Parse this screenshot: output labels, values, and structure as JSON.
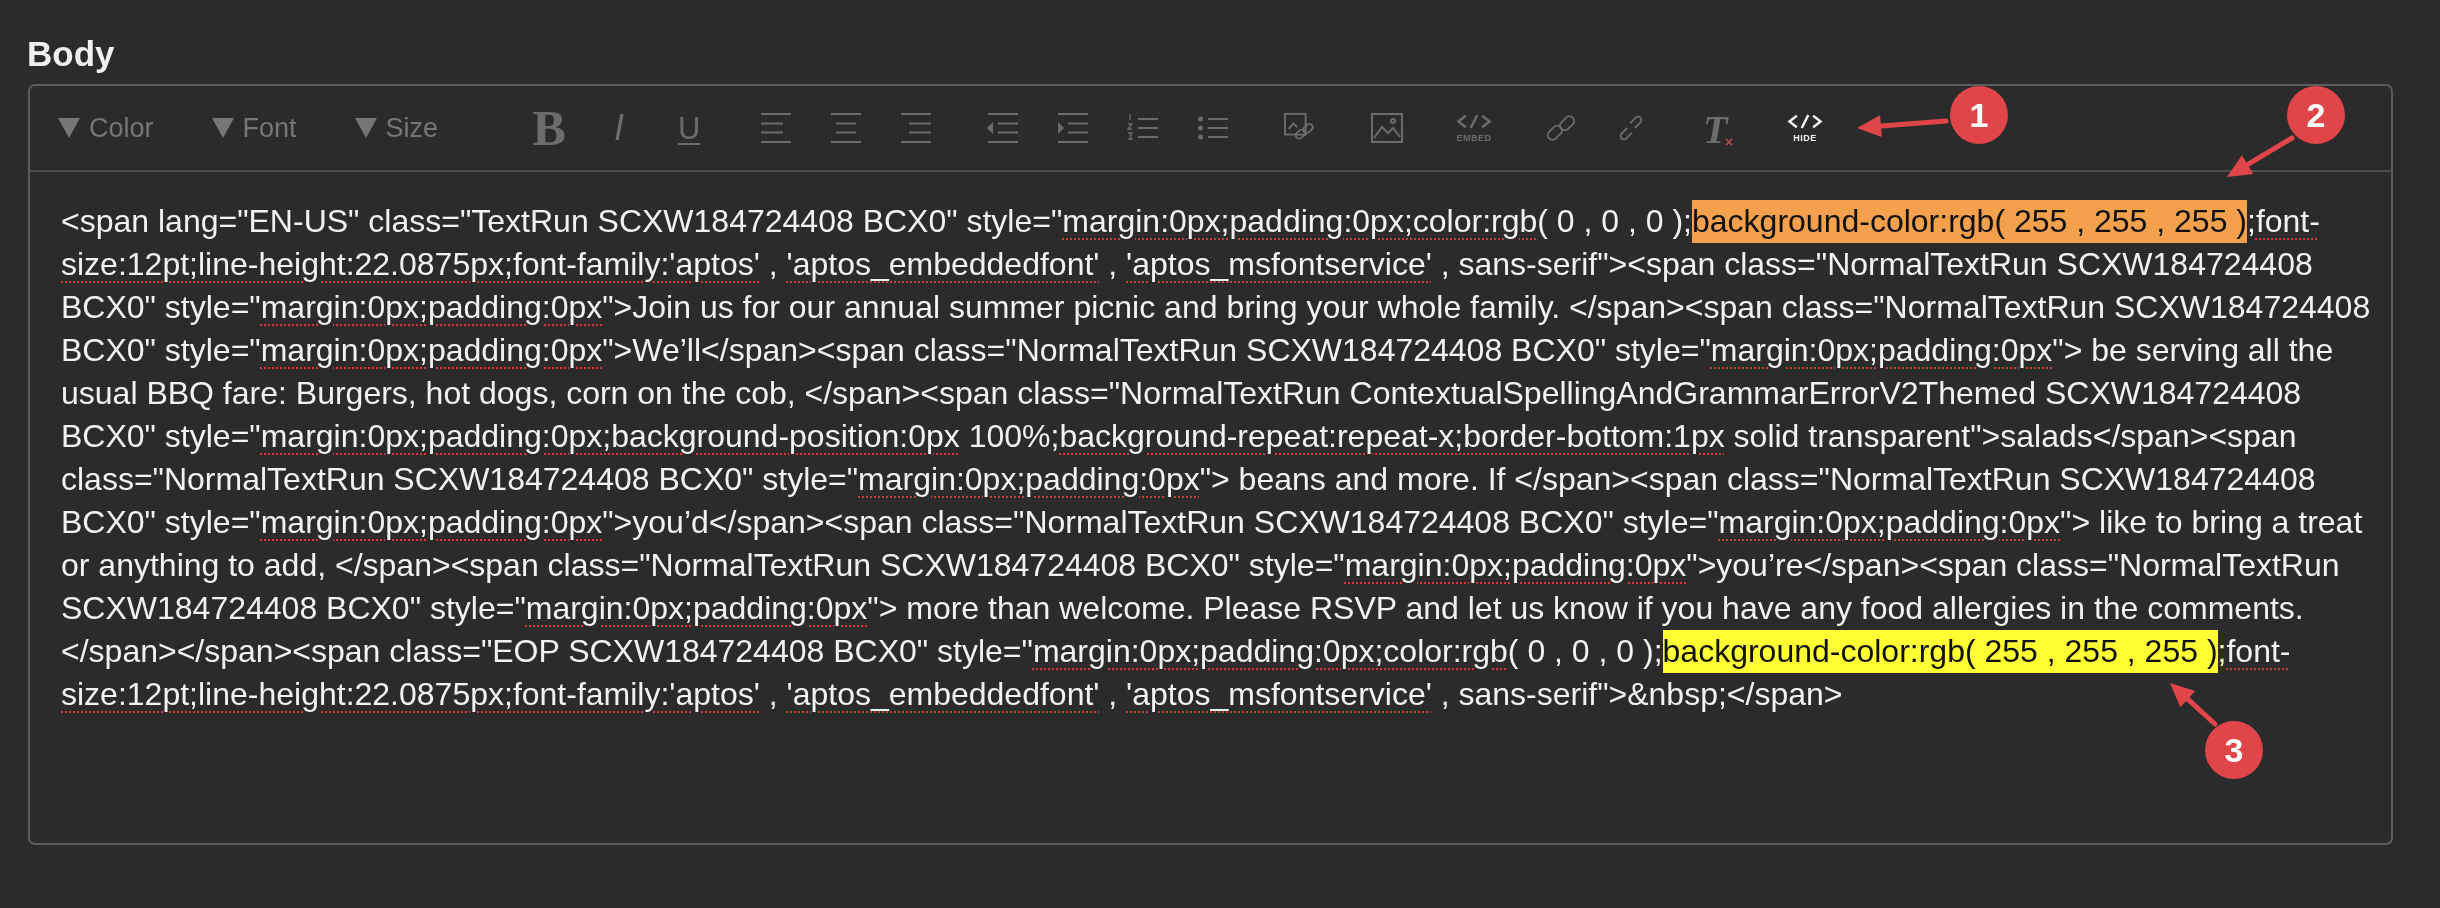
{
  "field": {
    "label": "Body"
  },
  "toolbar": {
    "dropdowns": [
      {
        "label": "Color",
        "disabled": true
      },
      {
        "label": "Font",
        "disabled": true
      },
      {
        "label": "Size",
        "disabled": true
      }
    ],
    "groups": [
      [
        {
          "kind": "bold",
          "label": "B",
          "disabled": true
        },
        {
          "kind": "italic",
          "label": "I",
          "disabled": true
        },
        {
          "kind": "underline",
          "label": "U",
          "disabled": true
        }
      ],
      [
        {
          "kind": "align-left",
          "disabled": true
        },
        {
          "kind": "align-center",
          "disabled": true
        },
        {
          "kind": "align-right",
          "disabled": true
        }
      ],
      [
        {
          "kind": "outdent",
          "disabled": true
        },
        {
          "kind": "indent",
          "disabled": true
        },
        {
          "kind": "numbered-list",
          "disabled": true
        },
        {
          "kind": "bulleted-list",
          "disabled": true
        }
      ],
      [
        {
          "kind": "media",
          "disabled": true
        }
      ],
      [
        {
          "kind": "image",
          "disabled": true
        }
      ],
      [
        {
          "kind": "embed",
          "label": "EMBED",
          "disabled": true
        }
      ],
      [
        {
          "kind": "link",
          "disabled": true
        },
        {
          "kind": "unlink",
          "disabled": true
        }
      ],
      [
        {
          "kind": "clear-format",
          "label": "T",
          "disabled": true
        }
      ],
      [
        {
          "kind": "source",
          "label": "HIDE",
          "disabled": false
        }
      ]
    ]
  },
  "editor": {
    "lines": [
      {
        "runs": [
          {
            "kind": "plain",
            "text": "<span lang=\"EN-US\" class=\"TextRun SCXW184724408 BCX0\" style=\""
          },
          {
            "kind": "misspelled",
            "text": "margin:0px;padding:0px;color:rgb"
          },
          {
            "kind": "plain",
            "text": "( 0 , 0 , 0 );"
          },
          {
            "kind": "highlight",
            "color": "#f4a04c",
            "text": "background-color:rgb( 255 , 255 , 255 )"
          },
          {
            "kind": "plain",
            "text": ";"
          },
          {
            "kind": "misspelled",
            "text": "font-"
          }
        ]
      },
      {
        "runs": [
          {
            "kind": "misspelled",
            "text": "size:12pt;line-height:22.0875px;font-family:'aptos'"
          },
          {
            "kind": "plain",
            "text": " , "
          },
          {
            "kind": "misspelled",
            "text": "'aptos_embeddedfont'"
          },
          {
            "kind": "plain",
            "text": " , "
          },
          {
            "kind": "misspelled",
            "text": "'aptos_msfontservice'"
          },
          {
            "kind": "plain",
            "text": " , sans-serif\"><span class=\"NormalTextRun SCXW184724408"
          }
        ]
      },
      {
        "runs": [
          {
            "kind": "plain",
            "text": "BCX0\" style=\""
          },
          {
            "kind": "misspelled",
            "text": "margin:0px;padding:0px"
          },
          {
            "kind": "plain",
            "text": "\">Join us for our annual summer picnic and bring your whole family. </span><span class=\"NormalTextRun SCXW184724408"
          }
        ]
      },
      {
        "runs": [
          {
            "kind": "plain",
            "text": "BCX0\" style=\""
          },
          {
            "kind": "misspelled",
            "text": "margin:0px;padding:0px"
          },
          {
            "kind": "plain",
            "text": "\">We’ll</span><span class=\"NormalTextRun SCXW184724408 BCX0\" style=\""
          },
          {
            "kind": "misspelled",
            "text": "margin:0px;padding:0px"
          },
          {
            "kind": "plain",
            "text": "\"> be serving all the"
          }
        ]
      },
      {
        "runs": [
          {
            "kind": "plain",
            "text": "usual BBQ fare: Burgers, hot dogs, corn on the cob, </span><span class=\"NormalTextRun ContextualSpellingAndGrammarErrorV2Themed SCXW184724408"
          }
        ]
      },
      {
        "runs": [
          {
            "kind": "plain",
            "text": "BCX0\" style=\""
          },
          {
            "kind": "misspelled",
            "text": "margin:0px;padding:0px;background-position:0px"
          },
          {
            "kind": "plain",
            "text": " 100%;"
          },
          {
            "kind": "misspelled",
            "text": "background-repeat:repeat-x;border-bottom:1px"
          },
          {
            "kind": "plain",
            "text": " solid transparent\">salads</span><span"
          }
        ]
      },
      {
        "runs": [
          {
            "kind": "plain",
            "text": "class=\"NormalTextRun SCXW184724408 BCX0\" style=\""
          },
          {
            "kind": "misspelled",
            "text": "margin:0px;padding:0px"
          },
          {
            "kind": "plain",
            "text": "\"> beans and more. If </span><span class=\"NormalTextRun SCXW184724408"
          }
        ]
      },
      {
        "runs": [
          {
            "kind": "plain",
            "text": "BCX0\" style=\""
          },
          {
            "kind": "misspelled",
            "text": "margin:0px;padding:0px"
          },
          {
            "kind": "plain",
            "text": "\">you’d</span><span class=\"NormalTextRun SCXW184724408 BCX0\" style=\""
          },
          {
            "kind": "misspelled",
            "text": "margin:0px;padding:0px"
          },
          {
            "kind": "plain",
            "text": "\"> like to bring a treat"
          }
        ]
      },
      {
        "runs": [
          {
            "kind": "plain",
            "text": "or anything to add, </span><span class=\"NormalTextRun SCXW184724408 BCX0\" style=\""
          },
          {
            "kind": "misspelled",
            "text": "margin:0px;padding:0px"
          },
          {
            "kind": "plain",
            "text": "\">you’re</span><span class=\"NormalTextRun"
          }
        ]
      },
      {
        "runs": [
          {
            "kind": "plain",
            "text": "SCXW184724408 BCX0\" style=\""
          },
          {
            "kind": "misspelled",
            "text": "margin:0px;padding:0px"
          },
          {
            "kind": "plain",
            "text": "\"> more than welcome. Please RSVP and let us know if you have any food allergies in the comments."
          }
        ]
      },
      {
        "runs": [
          {
            "kind": "plain",
            "text": "</span></span><span class=\"EOP SCXW184724408 BCX0\" style=\""
          },
          {
            "kind": "misspelled",
            "text": "margin:0px;padding:0px;color:rgb"
          },
          {
            "kind": "plain",
            "text": "( 0 , 0 , 0 );"
          },
          {
            "kind": "highlight",
            "color": "#ffff33",
            "text": "background-color:rgb( 255 , 255 , 255 )"
          },
          {
            "kind": "plain",
            "text": ";"
          },
          {
            "kind": "misspelled",
            "text": "font-"
          }
        ]
      },
      {
        "runs": [
          {
            "kind": "misspelled",
            "text": "size:12pt;line-height:22.0875px;font-family:'aptos'"
          },
          {
            "kind": "plain",
            "text": " , "
          },
          {
            "kind": "misspelled",
            "text": "'aptos_embeddedfont'"
          },
          {
            "kind": "plain",
            "text": " , "
          },
          {
            "kind": "misspelled",
            "text": "'aptos_msfontservice'"
          },
          {
            "kind": "plain",
            "text": " , sans-serif\">&nbsp;</span>"
          }
        ]
      }
    ]
  },
  "annotations": [
    {
      "number": "1"
    },
    {
      "number": "2"
    },
    {
      "number": "3"
    }
  ]
}
